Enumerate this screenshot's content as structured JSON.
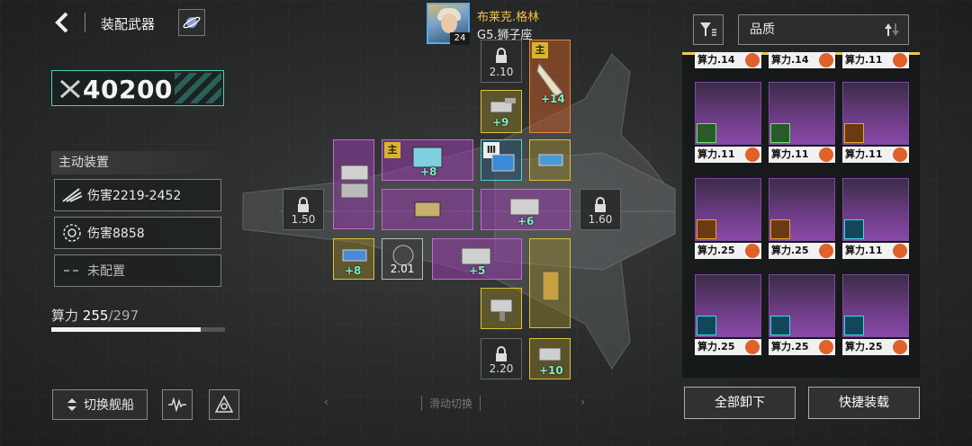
{
  "header": {
    "title": "装配武器"
  },
  "power": {
    "value": "40200"
  },
  "active_equipment": {
    "header": "主动装置",
    "stats": [
      {
        "icon": "claw-slash-icon",
        "label": "伤害2219-2452"
      },
      {
        "icon": "ring-target-icon",
        "label": "伤害8858"
      },
      {
        "icon": "dash-icon",
        "label": "未配置"
      }
    ]
  },
  "compute": {
    "label": "算力",
    "current": "255",
    "max": "/297",
    "fraction": 0.858
  },
  "bottom_left": {
    "switch_ship": "切换舰船"
  },
  "commander": {
    "name": "布莱克.格林",
    "class": "G5.狮子座",
    "level": "24"
  },
  "slots": {
    "locked": [
      "2.10",
      "1.50",
      "1.60",
      "2.20"
    ],
    "gray_value": "2.01",
    "main_tag": "主",
    "bonuses": [
      "+14",
      "+9",
      "+8",
      "+6",
      "+8",
      "+5",
      "+10"
    ]
  },
  "swipe_hint": "滑动切换",
  "sort": {
    "label": "品质"
  },
  "inventory": {
    "cost_prefix": "算力",
    "top_row": [
      "算力.14",
      "算力.14",
      "算力.11"
    ],
    "rows": [
      [
        "算力.11",
        "算力.11",
        "算力.11"
      ],
      [
        "算力.25",
        "算力.25",
        "算力.11"
      ],
      [
        "算力.25",
        "算力.25",
        "算力.25"
      ]
    ]
  },
  "buttons": {
    "unload_all": "全部卸下",
    "quick_equip": "快捷装载"
  },
  "colors": {
    "accent_teal": "#4fd1b0",
    "gold": "#f3c341",
    "purple": "#c06ad4",
    "cost_gear": "#e0612a"
  }
}
